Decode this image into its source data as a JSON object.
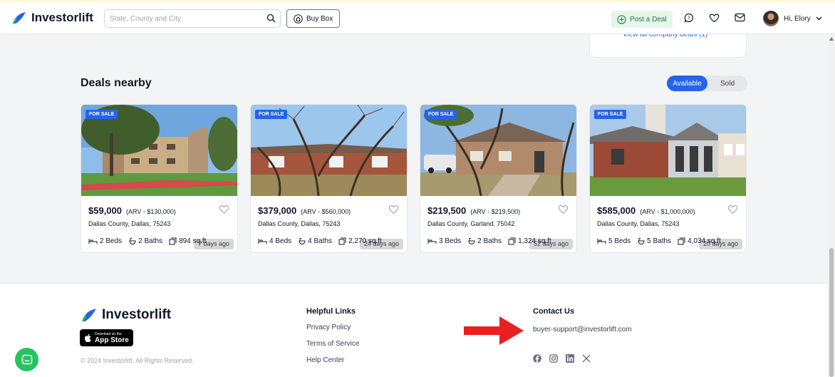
{
  "header": {
    "logo_text": "Investorlift",
    "search_placeholder": "State, County and City",
    "buy_box_label": "Buy Box",
    "post_deal_label": "Post a Deal",
    "user_greeting": "Hi, Elory"
  },
  "company_card": {
    "link_text": "View all company deals (1)"
  },
  "deals_section": {
    "title": "Deals nearby",
    "toggle": {
      "available_label": "Available",
      "sold_label": "Sold",
      "selected": "Available"
    }
  },
  "deals": [
    {
      "badge": "FOR SALE",
      "age": "7 days ago",
      "price": "$59,000",
      "arv": "(ARV - $130,000)",
      "location": "Dallas County, Dallas, 75243",
      "beds": "2 Beds",
      "baths": "2 Baths",
      "sqft": "894 sq.ft"
    },
    {
      "badge": "FOR SALE",
      "age": "24 days ago",
      "price": "$379,000",
      "arv": "(ARV - $560,000)",
      "location": "Dallas County, Dallas, 75243",
      "beds": "4 Beds",
      "baths": "4 Baths",
      "sqft": "2,270 sq.ft"
    },
    {
      "badge": "FOR SALE",
      "age": "52 days ago",
      "price": "$219,500",
      "arv": "(ARV - $219,500)",
      "location": "Dallas County, Garland, 75042",
      "beds": "3 Beds",
      "baths": "2 Baths",
      "sqft": "1,324 sq.ft"
    },
    {
      "badge": "FOR SALE",
      "age": "20 days ago",
      "price": "$585,000",
      "arv": "(ARV - $1,000,000)",
      "location": "Dallas County, Dallas, 75243",
      "beds": "5 Beds",
      "baths": "5 Baths",
      "sqft": "4,034 sq.ft"
    }
  ],
  "footer": {
    "logo_text": "Investorlift",
    "app_store_small": "Download on the",
    "app_store_big": "App Store",
    "copyright": "© 2024 Investorlift. All Rights Reserved.",
    "helpful_links_title": "Helpful Links",
    "links": [
      "Privacy Policy",
      "Terms of Service",
      "Help Center"
    ],
    "contact_title": "Contact Us",
    "contact_email": "buyer-support@investorlift.com",
    "socials": [
      "facebook-icon",
      "instagram-icon",
      "linkedin-icon",
      "x-icon"
    ]
  },
  "colors": {
    "brand_blue": "#2563eb",
    "brand_green": "#22c55e",
    "annotation_red": "#e8201f"
  }
}
